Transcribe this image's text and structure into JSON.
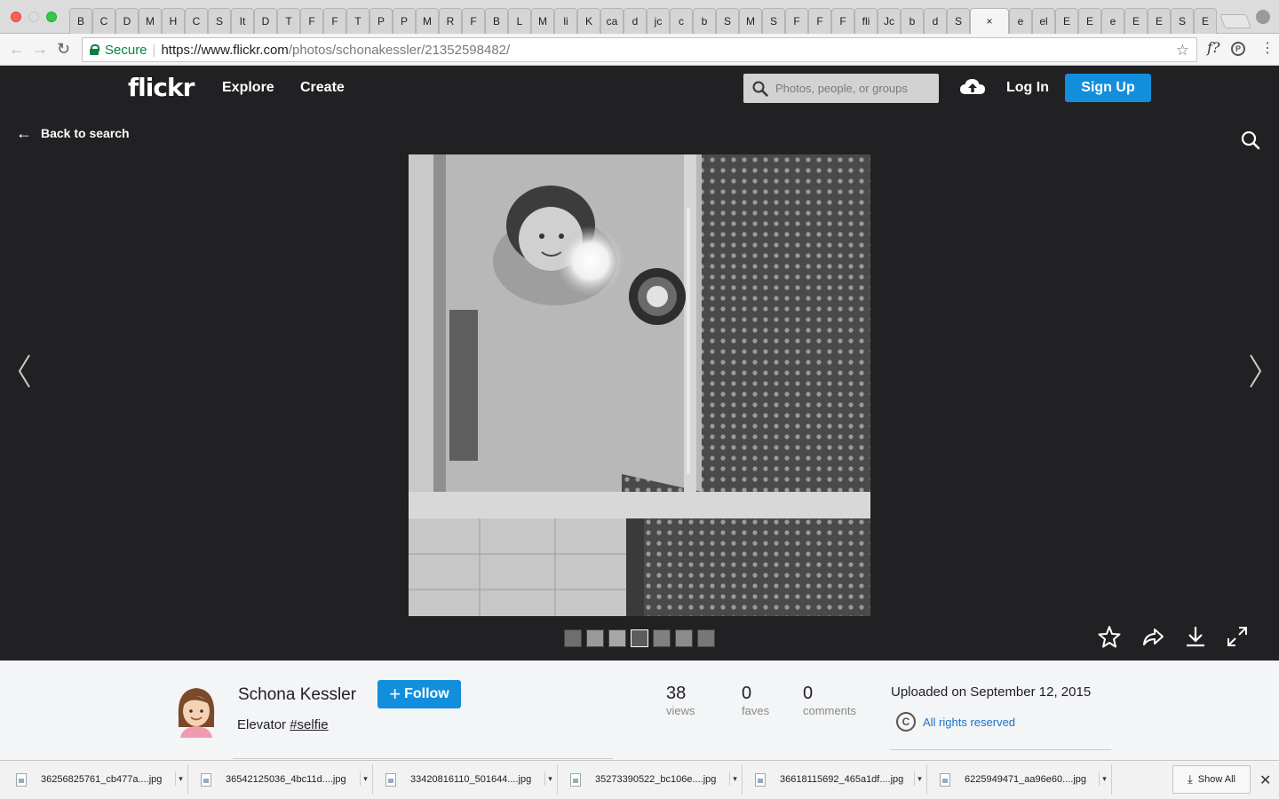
{
  "browser": {
    "tabs": [
      {
        "label": "B"
      },
      {
        "label": "C"
      },
      {
        "label": "D"
      },
      {
        "label": "M"
      },
      {
        "label": "H"
      },
      {
        "label": "C"
      },
      {
        "label": "S"
      },
      {
        "label": "It"
      },
      {
        "label": "D"
      },
      {
        "label": "T"
      },
      {
        "label": "F"
      },
      {
        "label": "F"
      },
      {
        "label": "T"
      },
      {
        "label": "P"
      },
      {
        "label": "P"
      },
      {
        "label": "M"
      },
      {
        "label": "R"
      },
      {
        "label": "F"
      },
      {
        "label": "B"
      },
      {
        "label": "L"
      },
      {
        "label": "M"
      },
      {
        "label": "li"
      },
      {
        "label": "K"
      },
      {
        "label": "ca"
      },
      {
        "label": "d"
      },
      {
        "label": "jc"
      },
      {
        "label": "c"
      },
      {
        "label": "b"
      },
      {
        "label": "S"
      },
      {
        "label": "M"
      },
      {
        "label": "S"
      },
      {
        "label": "F"
      },
      {
        "label": "F"
      },
      {
        "label": "F"
      },
      {
        "label": "fli"
      },
      {
        "label": "Jc"
      },
      {
        "label": "b"
      },
      {
        "label": "d"
      },
      {
        "label": "S"
      },
      {
        "label": "×",
        "active": true
      },
      {
        "label": "e"
      },
      {
        "label": "el"
      },
      {
        "label": "E"
      },
      {
        "label": "E"
      },
      {
        "label": "e"
      },
      {
        "label": "E"
      },
      {
        "label": "E"
      },
      {
        "label": "S"
      },
      {
        "label": "E"
      }
    ],
    "secure_label": "Secure",
    "url_scheme_host": "https://www.flickr.com",
    "url_path": "/photos/schonakessler/21352598482/"
  },
  "header": {
    "logo": "flickr",
    "nav": {
      "explore": "Explore",
      "create": "Create"
    },
    "search_placeholder": "Photos, people, or groups",
    "login": "Log In",
    "signup": "Sign Up"
  },
  "viewer": {
    "back_label": "Back to search",
    "filmstrip_count": 7,
    "active_thumb_index": 3
  },
  "photo_info": {
    "owner_name": "Schona Kessler",
    "follow_label": "Follow",
    "title_text": "Elevator",
    "title_tag": "#selfie",
    "stats": [
      {
        "value": "38",
        "label": "views"
      },
      {
        "value": "0",
        "label": "faves"
      },
      {
        "value": "0",
        "label": "comments"
      }
    ],
    "uploaded": "Uploaded on September 12, 2015",
    "license": "All rights reserved"
  },
  "downloads": {
    "items": [
      "36256825761_cb477a....jpg",
      "36542125036_4bc11d....jpg",
      "33420816110_501644....jpg",
      "35273390522_bc106e....jpg",
      "36618115692_465a1df....jpg",
      "6225949471_aa96e60....jpg"
    ],
    "show_all": "Show All"
  },
  "colors": {
    "flickr_dark": "#212124",
    "flickr_blue": "#128fdc",
    "secure_green": "#0b8043"
  }
}
